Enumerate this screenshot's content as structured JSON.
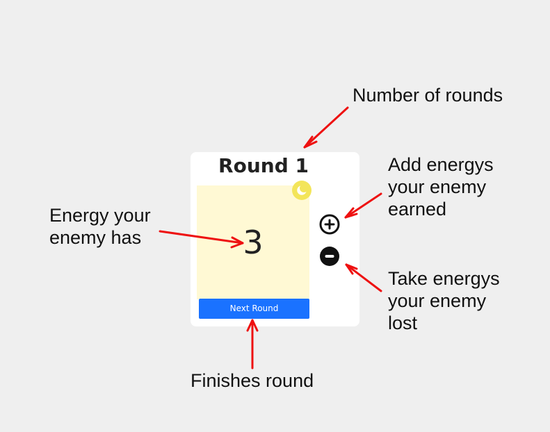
{
  "card": {
    "title": "Round 1",
    "energy_value": "3",
    "next_round_label": "Next Round",
    "icons": {
      "theme": "moon-icon",
      "add": "plus-circle-icon",
      "remove": "minus-circle-icon"
    }
  },
  "annotations": {
    "rounds": "Number of rounds",
    "energy": "Energy your\nenemy has",
    "add": "Add energys\nyour enemy\nearned",
    "take": "Take energys\nyour enemy\nlost",
    "finish": "Finishes round"
  },
  "colors": {
    "background": "#efefef",
    "energy_panel": "#fff9d4",
    "button": "#1a72ff",
    "moon_badge": "#f3e55a",
    "arrows": "#ee1111"
  }
}
